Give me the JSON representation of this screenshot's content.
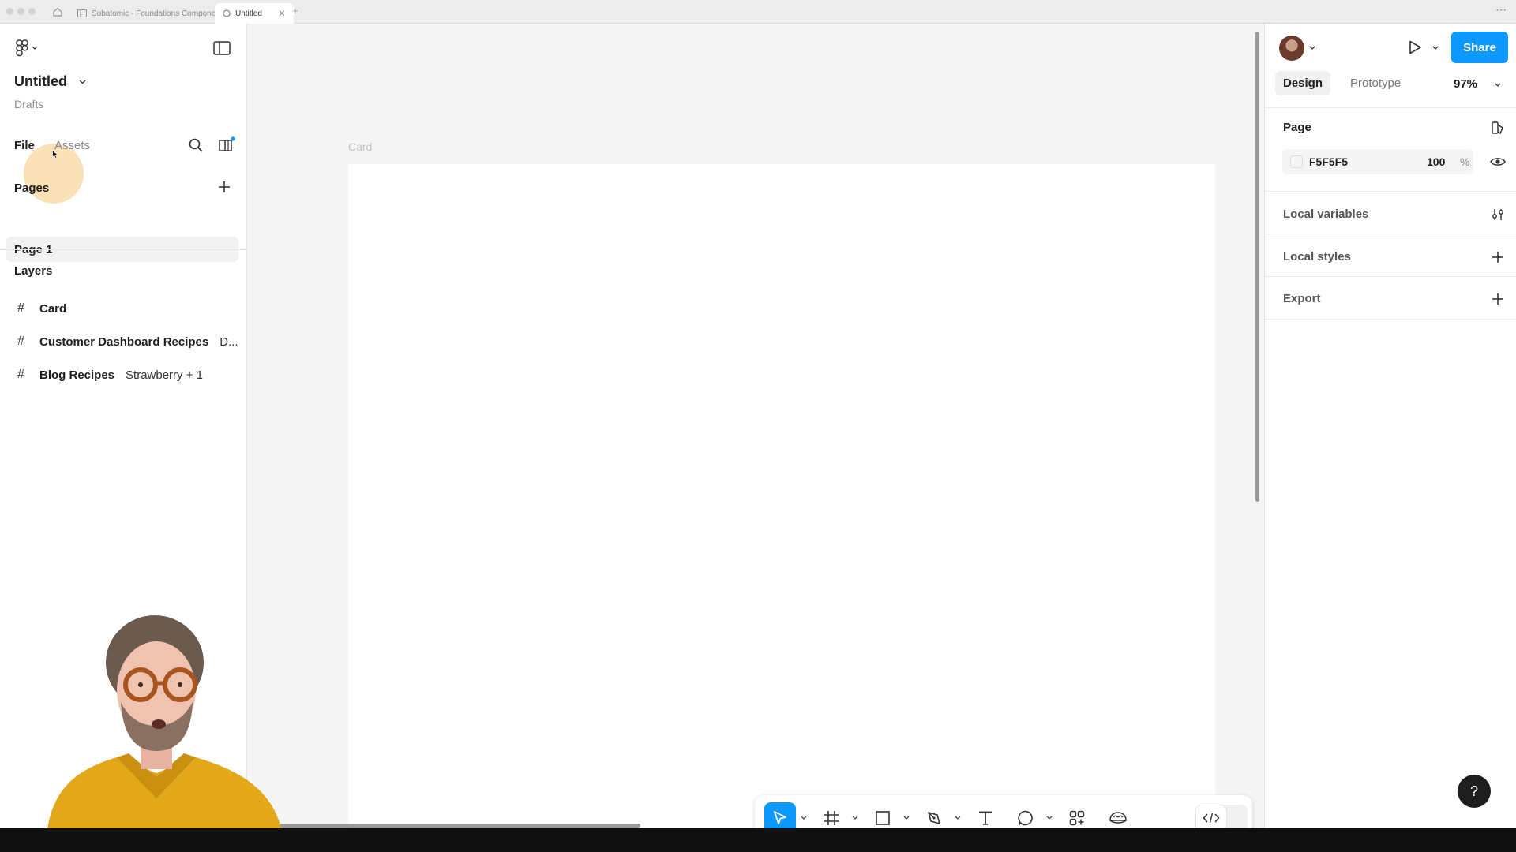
{
  "browser": {
    "tabs": [
      {
        "label": "Subatomic - Foundations Component"
      },
      {
        "label": "Untitled"
      }
    ],
    "new_tab": "+",
    "more": "⋯"
  },
  "file": {
    "title": "Untitled",
    "location": "Drafts"
  },
  "left_panel": {
    "tabs": [
      {
        "label": "File"
      },
      {
        "label": "Assets"
      }
    ],
    "pages_title": "Pages",
    "pages": [
      {
        "label": "Page 1"
      }
    ],
    "layers_title": "Layers",
    "layers": [
      {
        "name": "Card",
        "extra": ""
      },
      {
        "name": "Customer Dashboard Recipes",
        "extra": "D..."
      },
      {
        "name": "Blog Recipes",
        "extra": "Strawberry + 1"
      }
    ]
  },
  "canvas": {
    "frame_label": "Card",
    "background": "#F5F5F5"
  },
  "right_panel": {
    "share_label": "Share",
    "tabs": [
      {
        "label": "Design"
      },
      {
        "label": "Prototype"
      }
    ],
    "zoom": "97%",
    "page_title": "Page",
    "page_color": "F5F5F5",
    "page_opacity": "100",
    "opacity_unit": "%",
    "sections": [
      {
        "label": "Local variables"
      },
      {
        "label": "Local styles"
      },
      {
        "label": "Export"
      }
    ],
    "help": "?"
  },
  "colors": {
    "accent": "#0d99ff",
    "panel": "#ffffff",
    "canvas": "#f5f5f5"
  },
  "icons": {
    "toolbar": [
      "move-icon",
      "frame-icon",
      "rectangle-icon",
      "pen-icon",
      "text-icon",
      "comment-icon",
      "actions-icon",
      "ui3-icon",
      "dev-mode-icon"
    ]
  }
}
